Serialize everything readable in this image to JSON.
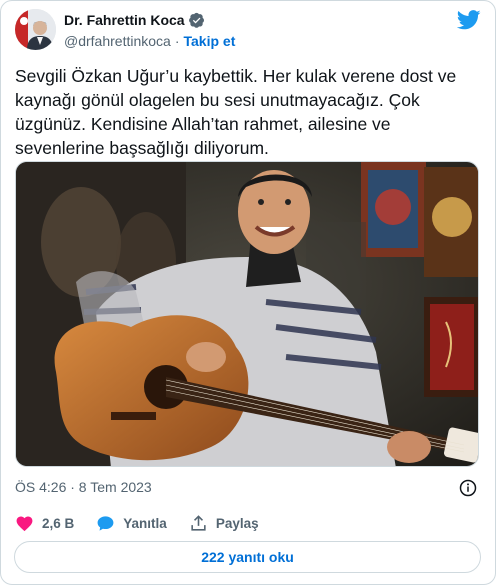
{
  "author": {
    "name": "Dr. Fahrettin Koca",
    "handle": "@drfahrettinkoca",
    "follow_label": "Takip et"
  },
  "tweet": {
    "text": "Sevgili Özkan Uğur’u kaybettik. Her kulak verene dost ve\nkaynağı gönül olagelen bu sesi unutmayacağız. Çok\nüzgünüz. Kendisine Allah’tan rahmet, ailesine ve\nsevenlerine başsağlığı diliyorum.",
    "timestamp": "ÖS 4:26 · 8 Tem 2023"
  },
  "actions": {
    "likes": "2,6 B",
    "reply_label": "Yanıtla",
    "share_label": "Paylaş"
  },
  "replies_button": "222 yanıtı oku",
  "colors": {
    "accent": "#1d9bf0",
    "link": "#006fd6",
    "like": "#f91880",
    "text": "#0f1419",
    "muted": "#536471",
    "border": "#cfd9de"
  },
  "icons": {
    "verified": "verified-badge-icon",
    "logo": "twitter-bird-icon",
    "info": "info-icon",
    "like": "heart-icon",
    "reply": "speech-bubble-icon",
    "share": "share-upload-icon"
  }
}
